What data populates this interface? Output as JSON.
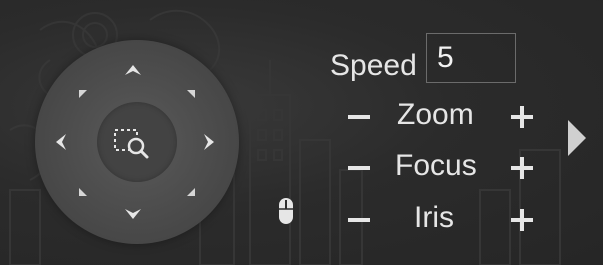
{
  "panel": {
    "speed_label": "Speed",
    "speed_value": "5",
    "zoom_label": "Zoom",
    "focus_label": "Focus",
    "iris_label": "Iris",
    "minus_glyph": "−",
    "plus_glyph": "+"
  },
  "icons": {
    "joystick": [
      "arrow-up-icon",
      "arrow-down-icon",
      "arrow-left-icon",
      "arrow-right-icon",
      "arrow-up-left-icon",
      "arrow-up-right-icon",
      "arrow-down-left-icon",
      "arrow-down-right-icon",
      "zoom-area-icon"
    ],
    "other": [
      "mouse-icon",
      "expand-right-icon"
    ]
  },
  "colors": {
    "background": "#2a2a2a",
    "text": "#e6e6e6",
    "joystick": "#4f4f4f"
  }
}
